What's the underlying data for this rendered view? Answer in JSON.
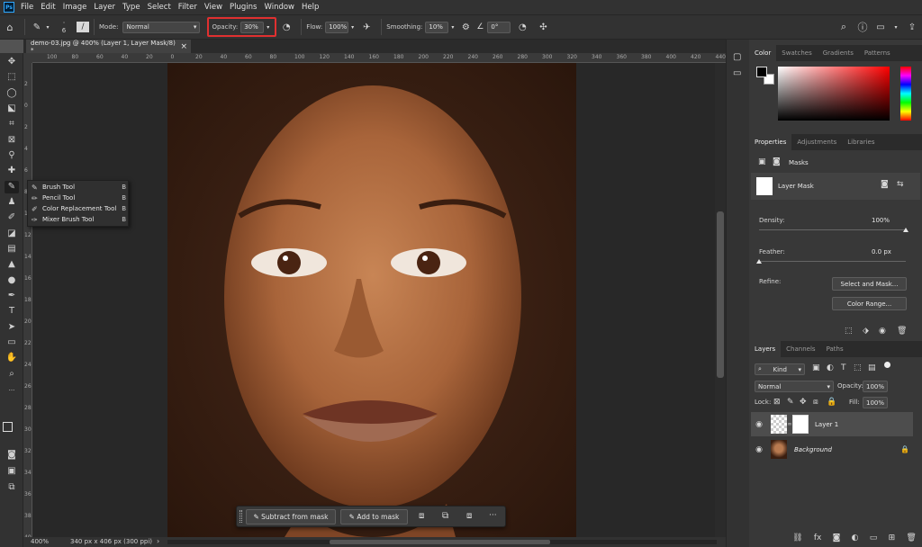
{
  "menubar": {
    "logo": "Ps",
    "items": [
      "File",
      "Edit",
      "Image",
      "Layer",
      "Type",
      "Select",
      "Filter",
      "View",
      "Plugins",
      "Window",
      "Help"
    ]
  },
  "options": {
    "brush_size": "6",
    "mode_label": "Mode:",
    "mode_value": "Normal",
    "opacity_label": "Opacity:",
    "opacity_value": "30%",
    "flow_label": "Flow:",
    "flow_value": "100%",
    "smoothing_label": "Smoothing:",
    "smoothing_value": "10%",
    "angle_value": "0°",
    "highlight_color": "#e03030"
  },
  "document": {
    "tab_title": "demo-03.jpg @ 400% (Layer 1, Layer Mask/8) *",
    "close": "×",
    "zoom": "400%",
    "size_info": "340 px x 406 px (300 ppi)",
    "ruler_top": [
      "100",
      "80",
      "60",
      "40",
      "20",
      "0",
      "20",
      "40",
      "60",
      "80",
      "100",
      "120",
      "140",
      "160",
      "180",
      "200",
      "220",
      "240",
      "260",
      "280",
      "300",
      "320",
      "340",
      "360",
      "380",
      "400",
      "420",
      "440"
    ],
    "ruler_left": [
      "2",
      "0",
      "2",
      "4",
      "6",
      "8",
      "10",
      "12",
      "14",
      "16",
      "18",
      "20",
      "22",
      "24",
      "26",
      "28",
      "30",
      "32",
      "34",
      "36",
      "38",
      "40"
    ]
  },
  "flyout": {
    "items": [
      {
        "label": "Brush Tool",
        "key": "B",
        "icon": "brush-icon"
      },
      {
        "label": "Pencil Tool",
        "key": "B",
        "icon": "pencil-icon"
      },
      {
        "label": "Color Replacement Tool",
        "key": "B",
        "icon": "color-replacement-icon"
      },
      {
        "label": "Mixer Brush Tool",
        "key": "B",
        "icon": "mixer-brush-icon"
      }
    ]
  },
  "maskbar": {
    "subtract": "Subtract from mask",
    "add": "Add to mask",
    "more": "···"
  },
  "color_panel": {
    "tabs": [
      "Color",
      "Swatches",
      "Gradients",
      "Patterns"
    ],
    "foreground": "#000000",
    "background": "#ffffff",
    "hue": "#ff0000"
  },
  "properties": {
    "tabs": [
      "Properties",
      "Adjustments",
      "Libraries"
    ],
    "section": "Masks",
    "mask_name": "Layer Mask",
    "density_label": "Density:",
    "density_value": "100%",
    "density_level": 1.0,
    "feather_label": "Feather:",
    "feather_value": "0.0 px",
    "feather_level": 0.0,
    "refine_label": "Refine:",
    "select_mask_btn": "Select and Mask...",
    "color_range_btn": "Color Range..."
  },
  "layers": {
    "tabs": [
      "Layers",
      "Channels",
      "Paths"
    ],
    "filter": "Kind",
    "blend": "Normal",
    "opacity_label": "Opacity:",
    "opacity_value": "100%",
    "lock_label": "Lock:",
    "fill_label": "Fill:",
    "fill_value": "100%",
    "items": [
      {
        "name": "Layer 1",
        "selected": true
      },
      {
        "name": "Background",
        "selected": false
      }
    ]
  }
}
